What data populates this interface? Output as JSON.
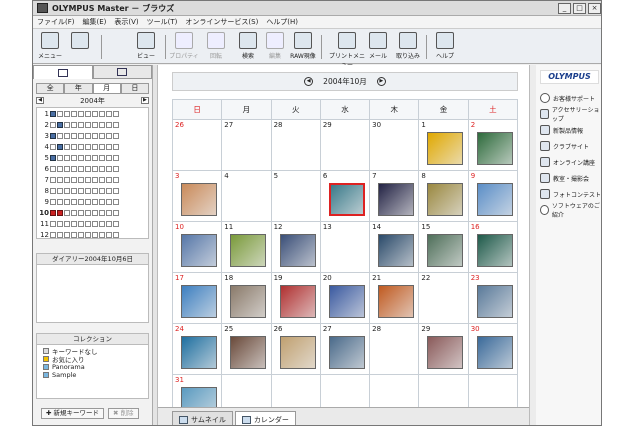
{
  "window": {
    "title": "OLYMPUS Master － ブラウズ"
  },
  "menu": [
    "ファイル(F)",
    "編集(E)",
    "表示(V)",
    "ツール(T)",
    "オンラインサービス(S)",
    "ヘルプ(H)"
  ],
  "toolbar": [
    {
      "label": "メニュー",
      "icon": "menu-icon",
      "enabled": true
    },
    {
      "label": "ビュー",
      "icon": "view-icon",
      "enabled": true
    },
    {
      "label": "プロパティ",
      "icon": "properties-icon",
      "enabled": false
    },
    {
      "label": "回転",
      "icon": "rotate-icon",
      "enabled": false
    },
    {
      "label": "検索",
      "icon": "search-icon",
      "enabled": true
    },
    {
      "label": "編集",
      "icon": "edit-icon",
      "enabled": false
    },
    {
      "label": "RAW現像",
      "icon": "raw-develop-icon",
      "enabled": true
    },
    {
      "label": "プリントメニュー",
      "icon": "print-icon",
      "enabled": true
    },
    {
      "label": "メール",
      "icon": "mail-icon",
      "enabled": true
    },
    {
      "label": "取り込み",
      "icon": "import-icon",
      "enabled": true
    },
    {
      "label": "ヘルプ",
      "icon": "help-icon",
      "enabled": true
    }
  ],
  "left": {
    "period_tabs": [
      "全",
      "年",
      "月",
      "日"
    ],
    "active_period": "月",
    "year": "2004年",
    "months": [
      {
        "n": "1",
        "marks": [
          "cam",
          "",
          "",
          "",
          "",
          "",
          "",
          "",
          "",
          ""
        ]
      },
      {
        "n": "2",
        "marks": [
          "",
          "cam",
          "",
          "",
          "",
          "",
          "",
          "",
          "",
          ""
        ]
      },
      {
        "n": "3",
        "marks": [
          "cam",
          "",
          "",
          "",
          "",
          "",
          "",
          "",
          "",
          ""
        ]
      },
      {
        "n": "4",
        "marks": [
          "",
          "cam",
          "",
          "",
          "",
          "",
          "",
          "",
          "",
          ""
        ]
      },
      {
        "n": "5",
        "marks": [
          "cam",
          "",
          "",
          "",
          "",
          "",
          "",
          "",
          "",
          ""
        ]
      },
      {
        "n": "6",
        "marks": [
          "",
          "",
          "",
          "",
          "",
          "",
          "",
          "",
          "",
          ""
        ]
      },
      {
        "n": "7",
        "marks": [
          "",
          "",
          "",
          "",
          "",
          "",
          "",
          "",
          "",
          ""
        ]
      },
      {
        "n": "8",
        "marks": [
          "",
          "",
          "",
          "",
          "",
          "",
          "",
          "",
          "",
          ""
        ]
      },
      {
        "n": "9",
        "marks": [
          "",
          "",
          "",
          "",
          "",
          "",
          "",
          "",
          "",
          ""
        ]
      },
      {
        "n": "10",
        "marks": [
          "red",
          "red",
          "",
          "",
          "",
          "",
          "",
          "",
          "",
          ""
        ],
        "current": true
      },
      {
        "n": "11",
        "marks": [
          "",
          "",
          "",
          "",
          "",
          "",
          "",
          "",
          "",
          ""
        ]
      },
      {
        "n": "12",
        "marks": [
          "",
          "",
          "",
          "",
          "",
          "",
          "",
          "",
          "",
          ""
        ]
      }
    ],
    "diary_title": "ダイアリー2004年10月6日",
    "collection_title": "コレクション",
    "collections": [
      "キーワードなし",
      "お気に入り",
      "Panorama",
      "Sample"
    ],
    "new_keyword_button": "新規キーワード",
    "delete_button": "削除"
  },
  "calendar": {
    "month_label": "2004年10月",
    "weekdays": [
      "日",
      "月",
      "火",
      "水",
      "木",
      "金",
      "土"
    ],
    "weeks": [
      [
        {
          "d": "26"
        },
        {
          "d": "27"
        },
        {
          "d": "28"
        },
        {
          "d": "29"
        },
        {
          "d": "30"
        },
        {
          "d": "1",
          "photo": "#e0a800"
        },
        {
          "d": "2",
          "photo": "#2e6b3c"
        }
      ],
      [
        {
          "d": "3",
          "photo": "#c98a5a"
        },
        {
          "d": "4"
        },
        {
          "d": "5"
        },
        {
          "d": "6",
          "photo": "#3a7a8a",
          "selected": true
        },
        {
          "d": "7",
          "photo": "#222244"
        },
        {
          "d": "8",
          "photo": "#9a8840"
        },
        {
          "d": "9",
          "photo": "#5b8ec7"
        }
      ],
      [
        {
          "d": "10",
          "photo": "#5677a8"
        },
        {
          "d": "11",
          "photo": "#7a9a3a"
        },
        {
          "d": "12",
          "photo": "#3a4f78"
        },
        {
          "d": "13"
        },
        {
          "d": "14",
          "photo": "#2a4a6a"
        },
        {
          "d": "15",
          "photo": "#4f6f5a"
        },
        {
          "d": "16",
          "photo": "#1e5a4a"
        }
      ],
      [
        {
          "d": "17",
          "photo": "#3d7fc0"
        },
        {
          "d": "18",
          "photo": "#8a7a6a"
        },
        {
          "d": "19",
          "photo": "#b03030"
        },
        {
          "d": "20",
          "photo": "#3a5aa0"
        },
        {
          "d": "21",
          "photo": "#c05a20"
        },
        {
          "d": "22"
        },
        {
          "d": "23",
          "photo": "#5a7a9a"
        }
      ],
      [
        {
          "d": "24",
          "photo": "#1e6fa0"
        },
        {
          "d": "25",
          "photo": "#6a4a3a"
        },
        {
          "d": "26",
          "photo": "#c0a070"
        },
        {
          "d": "27",
          "photo": "#4a6a8a"
        },
        {
          "d": "28"
        },
        {
          "d": "29",
          "photo": "#8a5a5a"
        },
        {
          "d": "30",
          "photo": "#3a6a9a"
        }
      ],
      [
        {
          "d": "31",
          "photo": "#5a9ac0"
        },
        {
          "d": ""
        },
        {
          "d": ""
        },
        {
          "d": ""
        },
        {
          "d": ""
        },
        {
          "d": ""
        },
        {
          "d": ""
        }
      ]
    ]
  },
  "bottom_tabs": [
    {
      "label": "サムネイル",
      "active": false
    },
    {
      "label": "カレンダー",
      "active": true
    }
  ],
  "right": {
    "brand": "OLYMPUS",
    "links": [
      {
        "label": "お客様サポート",
        "icon": "help-circle-icon"
      },
      {
        "label": "アクセサリーショップ",
        "icon": "shop-icon"
      },
      {
        "label": "新製品情報",
        "icon": "new-product-icon"
      },
      {
        "label": "クラブサイト",
        "icon": "club-icon"
      },
      {
        "label": "オンライン講座",
        "icon": "lesson-icon"
      },
      {
        "label": "教室・撮影会",
        "icon": "class-icon"
      },
      {
        "label": "フォトコンテスト",
        "icon": "contest-icon"
      },
      {
        "label": "ソフトウェアのご紹介",
        "icon": "software-icon"
      }
    ]
  }
}
